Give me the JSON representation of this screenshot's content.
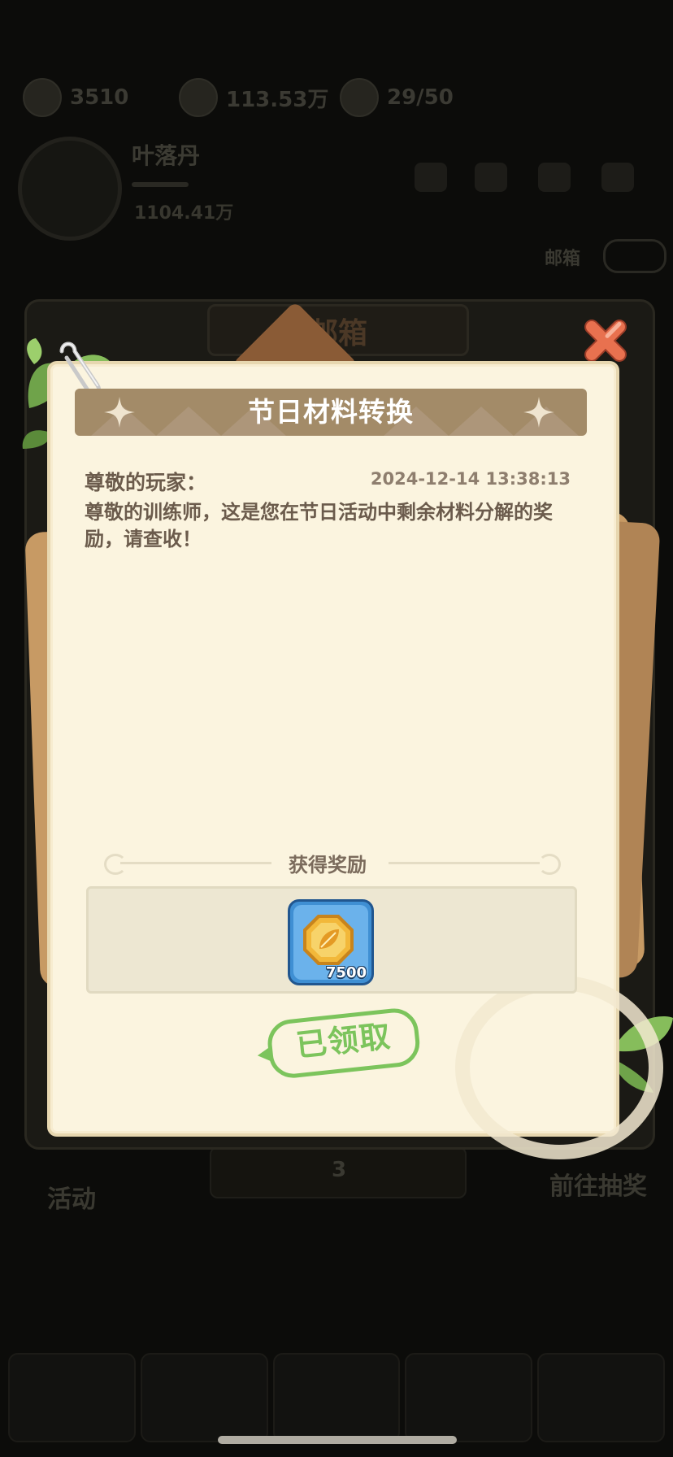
{
  "background": {
    "resources": [
      {
        "icon": "stamina-icon",
        "value": "3510"
      },
      {
        "icon": "coin-icon",
        "value": "113.53万"
      },
      {
        "icon": "plant-icon",
        "value": "29/50"
      }
    ],
    "player": {
      "name": "叶落丹",
      "power": "1104.41万"
    },
    "mail_tag": "邮箱",
    "bottom_bar": {
      "left_small": "…",
      "left_label": "活动",
      "center_value": "3",
      "right_label": "前往抽奖"
    },
    "tip": ""
  },
  "mailbox": {
    "title": "邮箱"
  },
  "mail": {
    "title": "节日材料转换",
    "greeting": "尊敬的玩家：",
    "timestamp": "2024-12-14 13:38:13",
    "body": "尊敬的训练师，这是您在节日活动中剩余材料分解的奖励，请查收！",
    "reward_heading": "获得奖励",
    "rewards": [
      {
        "icon": "gold-coin-icon",
        "count": "7500"
      }
    ],
    "status": "已领取"
  },
  "colors": {
    "title_bar": "#a38b68",
    "paper": "#fbf4df",
    "claimed_green": "#7cc45c",
    "close_orange": "#e8714f",
    "item_blue": "#3f8fd3"
  }
}
